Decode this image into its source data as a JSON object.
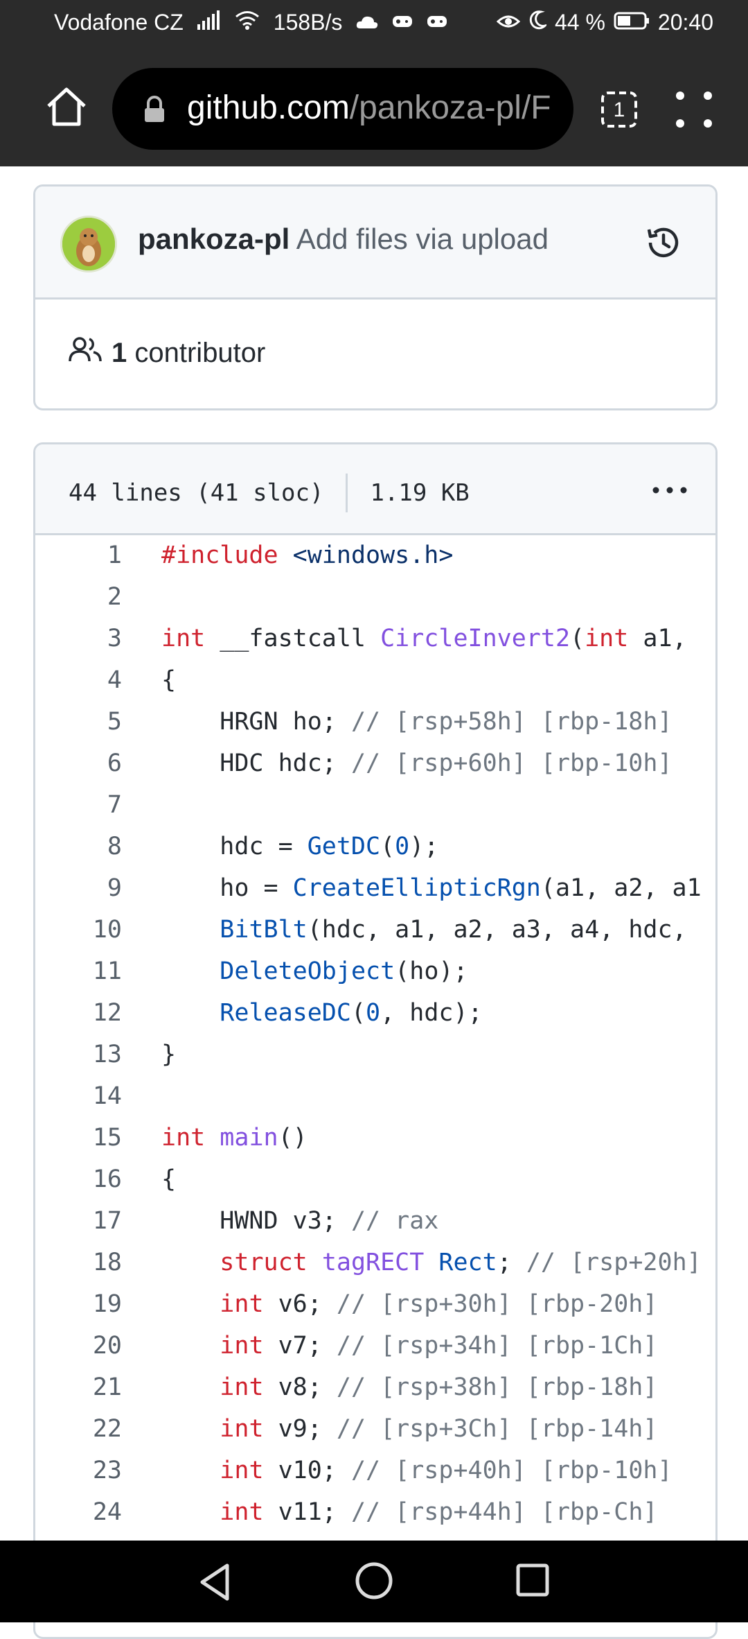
{
  "status_bar": {
    "carrier": "Vodafone CZ",
    "speed": "158B/s",
    "battery": "44 %",
    "time": "20:40"
  },
  "browser": {
    "url_host": "github.com",
    "url_path": "/pankoza-pl/F",
    "tab_count": "1"
  },
  "commit": {
    "author": "pankoza-pl",
    "message": "Add files via upload",
    "contributors_count": "1",
    "contributors_label": "contributor"
  },
  "file": {
    "lines": "44 lines (41 sloc)",
    "size": "1.19 KB"
  },
  "code_lines": [
    {
      "n": "1",
      "parts": [
        [
          "kw",
          "#include"
        ],
        [
          "",
          " "
        ],
        [
          "str",
          "<windows.h>"
        ]
      ]
    },
    {
      "n": "2",
      "parts": []
    },
    {
      "n": "3",
      "parts": [
        [
          "kw",
          "int"
        ],
        [
          "",
          " __fastcall "
        ],
        [
          "fn",
          "CircleInvert2"
        ],
        [
          "",
          "("
        ],
        [
          "kw",
          "int"
        ],
        [
          "",
          " a1, "
        ]
      ]
    },
    {
      "n": "4",
      "parts": [
        [
          "",
          "{"
        ]
      ]
    },
    {
      "n": "5",
      "parts": [
        [
          "",
          "    HRGN ho; "
        ],
        [
          "cm",
          "// [rsp+58h] [rbp-18h]"
        ]
      ]
    },
    {
      "n": "6",
      "parts": [
        [
          "",
          "    HDC hdc; "
        ],
        [
          "cm",
          "// [rsp+60h] [rbp-10h]"
        ]
      ]
    },
    {
      "n": "7",
      "parts": []
    },
    {
      "n": "8",
      "parts": [
        [
          "",
          "    hdc = "
        ],
        [
          "api",
          "GetDC"
        ],
        [
          "",
          "("
        ],
        [
          "num",
          "0"
        ],
        [
          "",
          ");"
        ]
      ]
    },
    {
      "n": "9",
      "parts": [
        [
          "",
          "    ho = "
        ],
        [
          "api",
          "CreateEllipticRgn"
        ],
        [
          "",
          "(a1, a2, a1"
        ]
      ]
    },
    {
      "n": "10",
      "parts": [
        [
          "",
          "    "
        ],
        [
          "api",
          "BitBlt"
        ],
        [
          "",
          "(hdc, a1, a2, a3, a4, hdc,"
        ]
      ]
    },
    {
      "n": "11",
      "parts": [
        [
          "",
          "    "
        ],
        [
          "api",
          "DeleteObject"
        ],
        [
          "",
          "(ho);"
        ]
      ]
    },
    {
      "n": "12",
      "parts": [
        [
          "",
          "    "
        ],
        [
          "api",
          "ReleaseDC"
        ],
        [
          "",
          "("
        ],
        [
          "num",
          "0"
        ],
        [
          "",
          ", hdc);"
        ]
      ]
    },
    {
      "n": "13",
      "parts": [
        [
          "",
          "}"
        ]
      ]
    },
    {
      "n": "14",
      "parts": []
    },
    {
      "n": "15",
      "parts": [
        [
          "kw",
          "int"
        ],
        [
          "",
          " "
        ],
        [
          "fn",
          "main"
        ],
        [
          "",
          "()"
        ]
      ]
    },
    {
      "n": "16",
      "parts": [
        [
          "",
          "{"
        ]
      ]
    },
    {
      "n": "17",
      "parts": [
        [
          "",
          "    HWND v3; "
        ],
        [
          "cm",
          "// rax"
        ]
      ]
    },
    {
      "n": "18",
      "parts": [
        [
          "",
          "    "
        ],
        [
          "kw",
          "struct"
        ],
        [
          "",
          " "
        ],
        [
          "fn",
          "tagRECT"
        ],
        [
          "",
          " "
        ],
        [
          "api",
          "Rect"
        ],
        [
          "",
          "; "
        ],
        [
          "cm",
          "// [rsp+20h]"
        ]
      ]
    },
    {
      "n": "19",
      "parts": [
        [
          "",
          "    "
        ],
        [
          "kw",
          "int"
        ],
        [
          "",
          " v6; "
        ],
        [
          "cm",
          "// [rsp+30h] [rbp-20h]"
        ]
      ]
    },
    {
      "n": "20",
      "parts": [
        [
          "",
          "    "
        ],
        [
          "kw",
          "int"
        ],
        [
          "",
          " v7; "
        ],
        [
          "cm",
          "// [rsp+34h] [rbp-1Ch]"
        ]
      ]
    },
    {
      "n": "21",
      "parts": [
        [
          "",
          "    "
        ],
        [
          "kw",
          "int"
        ],
        [
          "",
          " v8; "
        ],
        [
          "cm",
          "// [rsp+38h] [rbp-18h]"
        ]
      ]
    },
    {
      "n": "22",
      "parts": [
        [
          "",
          "    "
        ],
        [
          "kw",
          "int"
        ],
        [
          "",
          " v9; "
        ],
        [
          "cm",
          "// [rsp+3Ch] [rbp-14h]"
        ]
      ]
    },
    {
      "n": "23",
      "parts": [
        [
          "",
          "    "
        ],
        [
          "kw",
          "int"
        ],
        [
          "",
          " v10; "
        ],
        [
          "cm",
          "// [rsp+40h] [rbp-10h]"
        ]
      ]
    },
    {
      "n": "24",
      "parts": [
        [
          "",
          "    "
        ],
        [
          "kw",
          "int"
        ],
        [
          "",
          " v11; "
        ],
        [
          "cm",
          "// [rsp+44h] [rbp-Ch]"
        ]
      ]
    }
  ]
}
